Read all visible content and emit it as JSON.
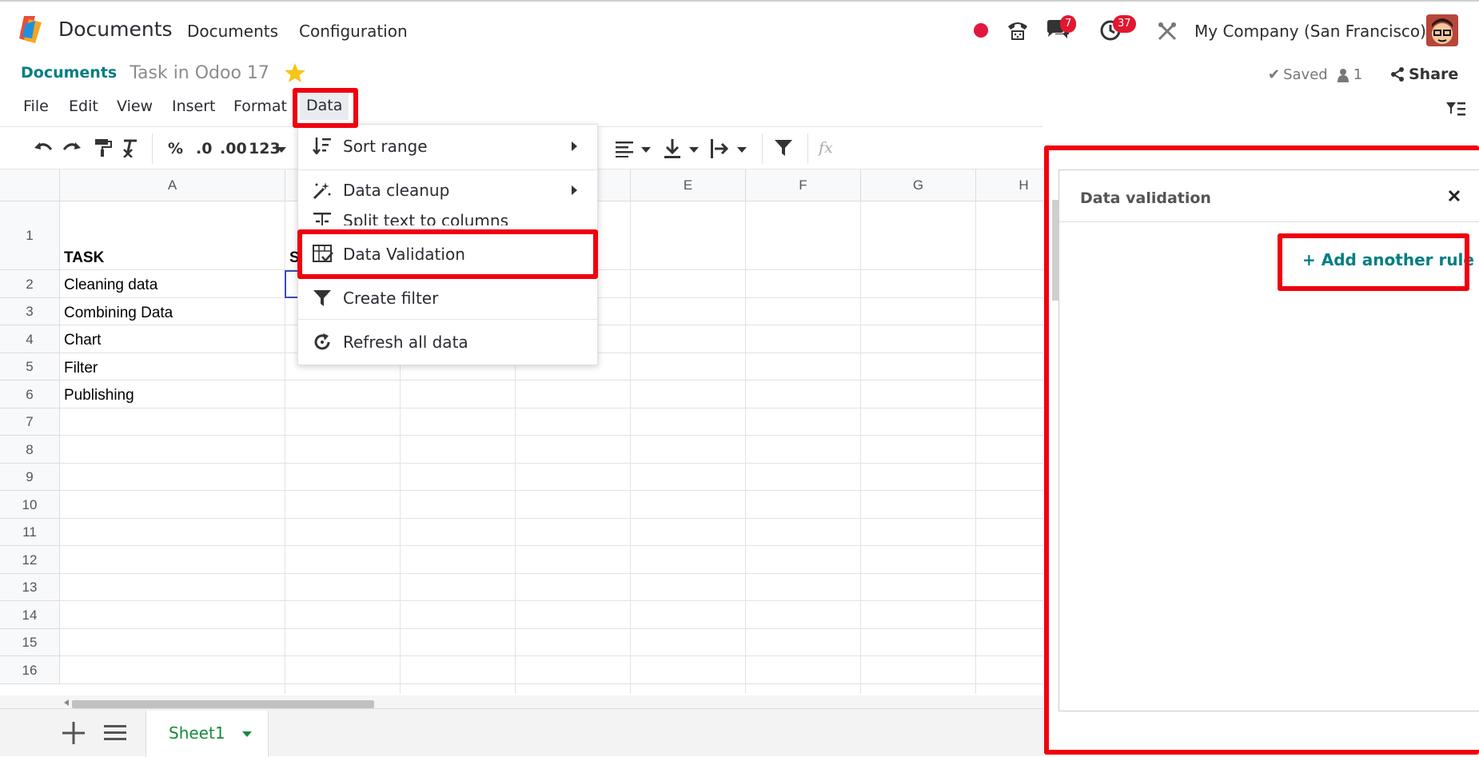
{
  "topnav": {
    "app_name": "Documents",
    "menu": [
      "Documents",
      "Configuration"
    ],
    "messages_badge": "7",
    "activities_badge": "37",
    "company": "My Company (San Francisco)"
  },
  "control_panel": {
    "breadcrumb": "Documents",
    "doc_name": "Task in Odoo 17",
    "saved_label": "Saved",
    "users_count": "1",
    "share_label": "Share"
  },
  "menubar": {
    "items": [
      "File",
      "Edit",
      "View",
      "Insert",
      "Format",
      "Data"
    ]
  },
  "toolbar": {
    "percent": "%",
    "dec_less": ".0",
    "dec_more": ".00",
    "number_format": "123",
    "fx": "fx"
  },
  "grid": {
    "columns": [
      "A",
      "E",
      "F",
      "G",
      "H"
    ],
    "rows": [
      "1",
      "2",
      "3",
      "4",
      "5",
      "6",
      "7",
      "8",
      "9",
      "10",
      "11",
      "12",
      "13",
      "14",
      "15",
      "16"
    ],
    "header_cell": "TASK",
    "col_b_partial": "S",
    "cells": [
      "Cleaning data",
      "Combining Data",
      "Chart",
      "Filter",
      "Publishing"
    ]
  },
  "data_menu": {
    "items": [
      "Sort range",
      "Data cleanup",
      "Split text to columns",
      "Data Validation",
      "Create filter",
      "Refresh all data"
    ]
  },
  "side_panel": {
    "title": "Data validation",
    "add_rule": "+ Add another rule"
  },
  "bottom": {
    "sheet_name": "Sheet1"
  },
  "colors": {
    "brand_teal": "#017e84",
    "highlight_red": "#f0000f",
    "badge_red": "#e2172f",
    "sheet_green": "#1a8a3a"
  }
}
